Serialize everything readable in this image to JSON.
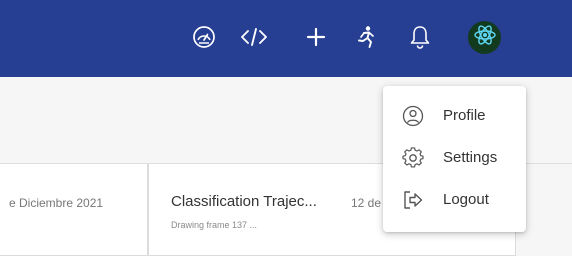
{
  "topbar": {
    "icons": [
      "dashboard-icon",
      "code-icon",
      "plus-icon",
      "run-icon",
      "bell-icon"
    ],
    "avatar": "react-atom-icon",
    "background": "#263f92"
  },
  "cards": {
    "left": {
      "date": "e Diciembre 2021"
    },
    "right": {
      "title": "Classification Trajec...",
      "date": "12 de",
      "subtitle": "Drawing frame 137 ..."
    }
  },
  "menu": {
    "items": [
      {
        "label": "Profile",
        "icon": "user-circle-icon"
      },
      {
        "label": "Settings",
        "icon": "gear-icon"
      },
      {
        "label": "Logout",
        "icon": "logout-icon"
      }
    ]
  }
}
